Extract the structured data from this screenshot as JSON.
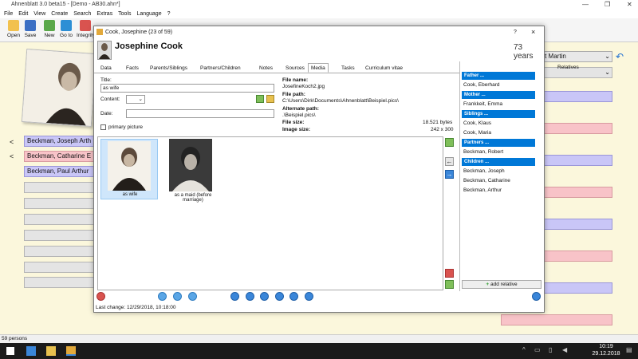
{
  "app": {
    "title": "Ahnenblatt 3.0 beta15 - [Demo - AB30.ahn*]",
    "menu": [
      "File",
      "Edit",
      "View",
      "Create",
      "Search",
      "Extras",
      "Tools",
      "Language",
      "?"
    ],
    "toolbar": [
      "Open",
      "Save",
      "New",
      "Go to",
      "Integrity"
    ],
    "status": "59 persons",
    "ages_right": "ert Martin"
  },
  "background": {
    "rows_left": [
      {
        "label": "Beckman, Joseph Arth",
        "color": "blue"
      },
      {
        "label": "Beckman, Catharine E",
        "color": "pink"
      },
      {
        "label": "Beckman, Paul Arthur",
        "color": "blue"
      }
    ],
    "arrows": [
      "<",
      "<"
    ]
  },
  "dialog": {
    "title": "Cook, Josephine (23 of 59)",
    "help": "?",
    "close": "×",
    "person_name": "Josephine Cook",
    "age": "73 years",
    "tabs": [
      "Data",
      "Facts",
      "Parents/Siblings",
      "Partners/Children",
      "Notes",
      "Sources",
      "Media",
      "Tasks",
      "Curriculum vitae"
    ],
    "media_form": {
      "title_label": "Title:",
      "title_value": "as wife",
      "content_label": "Content:",
      "date_label": "Date:",
      "date_value": "",
      "primary_label": "primary picture"
    },
    "file_info": {
      "file_name_label": "File name:",
      "file_name": "JosefineKoch2.jpg",
      "file_path_label": "File path:",
      "file_path": "C:\\Users\\Dirk\\Documents\\Ahnenblatt\\Beispiel.pics\\",
      "alt_path_label": "Alternate path:",
      "alt_path": ".\\Beispiel.pics\\",
      "file_size_label": "File size:",
      "file_size": "18.521 bytes",
      "image_size_label": "Image size:",
      "image_size": "242 x 300"
    },
    "thumbnails": [
      {
        "caption": "as wife"
      },
      {
        "caption": "as a maid (before marriage)"
      }
    ],
    "relatives": {
      "header": "Relatives",
      "sections": [
        {
          "title": "Father ...",
          "items": [
            "Cook, Eberhard"
          ]
        },
        {
          "title": "Mother ...",
          "items": [
            "Frankkeit, Emma"
          ]
        },
        {
          "title": "Siblings ...",
          "items": [
            "Cook, Klaus",
            "Cook, Maria"
          ]
        },
        {
          "title": "Partners ...",
          "items": [
            "Beckman, Robert"
          ]
        },
        {
          "title": "Children ...",
          "items": [
            "Beckman, Joseph",
            "Beckman, Catharine",
            "Beckman, Arthur"
          ]
        }
      ],
      "add_label": "add relative"
    },
    "last_change": "Last change: 12/29/2018, 10:18:00"
  },
  "taskbar": {
    "time": "10:19",
    "date": "29.12.2018"
  },
  "colors": {
    "accent": "#0078d7",
    "bg": "#fbf7dc",
    "blue_box": "#c9c6f7",
    "pink_box": "#f8c3c8"
  }
}
